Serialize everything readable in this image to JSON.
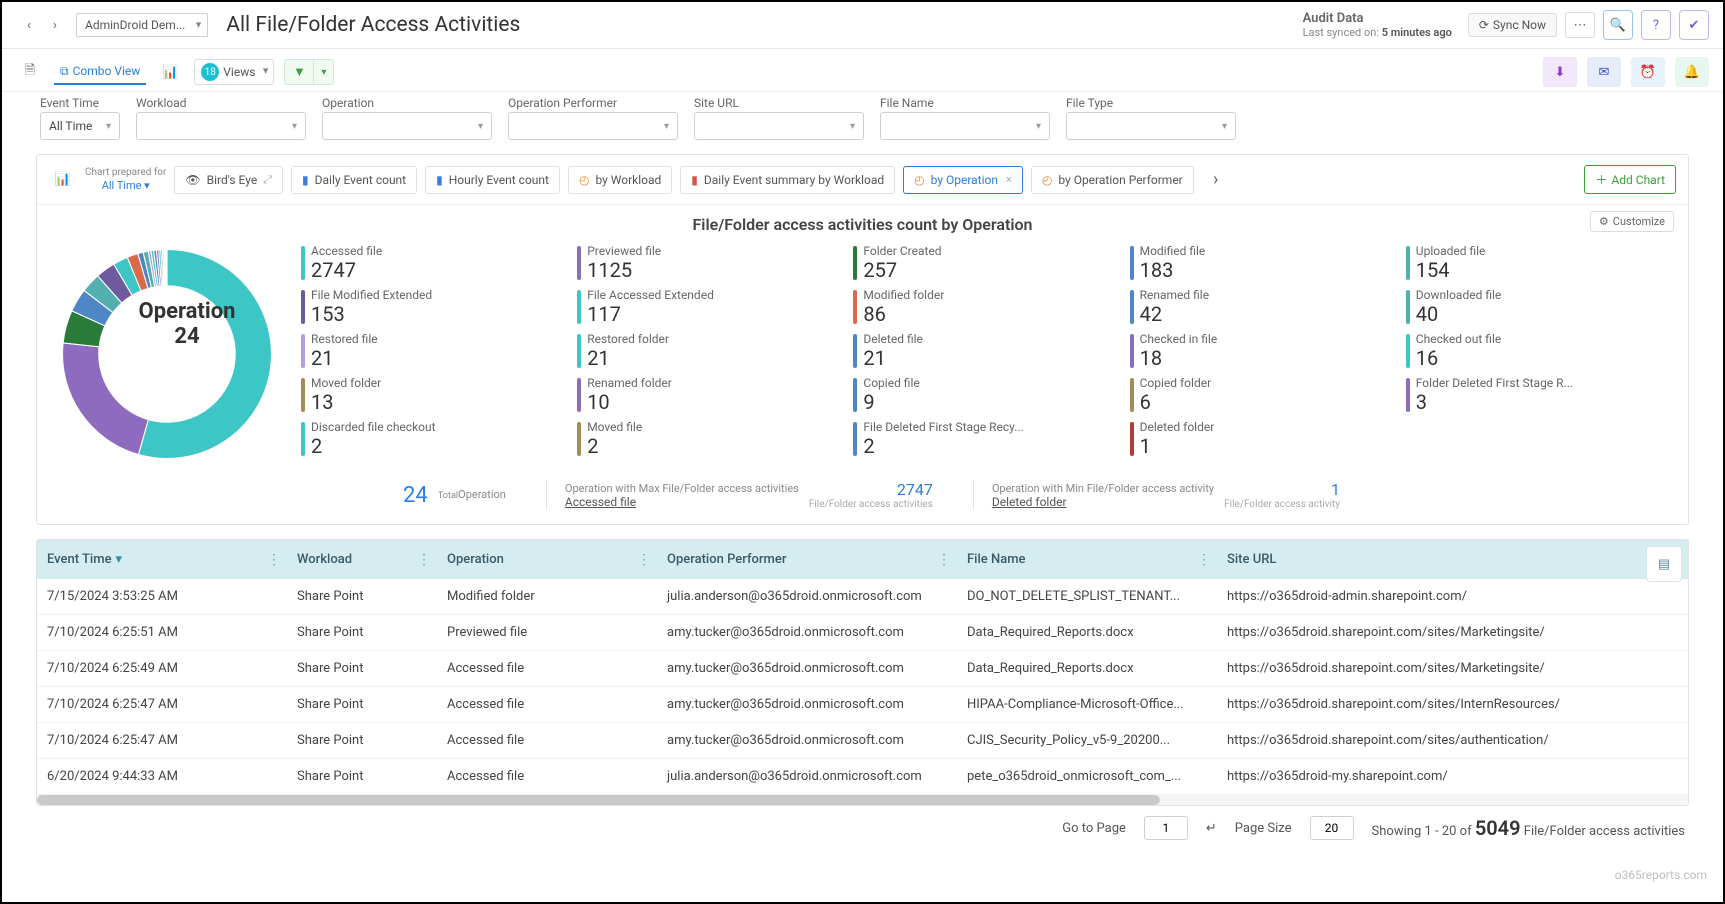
{
  "header": {
    "tenant": "AdminDroid Dem...",
    "page_title": "All File/Folder Access Activities",
    "audit_label": "Audit Data",
    "synced_label": "Last synced on:",
    "synced_value": "5 minutes ago",
    "sync_btn": "Sync Now"
  },
  "toolbar": {
    "combo_label": "Combo View",
    "views_label": "Views",
    "views_count": "18"
  },
  "filters": {
    "event_time": {
      "label": "Event Time",
      "value": "All Time"
    },
    "workload": {
      "label": "Workload",
      "value": ""
    },
    "operation": {
      "label": "Operation",
      "value": ""
    },
    "performer": {
      "label": "Operation Performer",
      "value": ""
    },
    "site_url": {
      "label": "Site URL",
      "value": ""
    },
    "file_name": {
      "label": "File Name",
      "value": ""
    },
    "file_type": {
      "label": "File Type",
      "value": ""
    }
  },
  "chart": {
    "prepared_label": "Chart prepared for",
    "prepared_value": "All Time",
    "tabs": {
      "birds_eye": "Bird's Eye",
      "daily": "Daily Event count",
      "hourly": "Hourly Event count",
      "by_workload": "by Workload",
      "daily_workload": "Daily Event summary by Workload",
      "by_operation": "by Operation",
      "by_performer": "by Operation Performer"
    },
    "add_chart": "Add Chart",
    "title": "File/Folder access activities count by Operation",
    "customize": "Customize",
    "donut_label": "Operation",
    "donut_value": "24",
    "footer": {
      "total_num": "24",
      "total_label_small": "Total",
      "total_label": "Operation",
      "max_label": "Operation with Max File/Folder access activities",
      "max_link": "Accessed file",
      "max_num": "2747",
      "max_sub": "File/Folder access activities",
      "min_label": "Operation with Min File/Folder access activity",
      "min_link": "Deleted folder",
      "min_num": "1",
      "min_sub": "File/Folder access activity"
    }
  },
  "chart_data": {
    "type": "pie",
    "title": "File/Folder access activities count by Operation",
    "series": [
      {
        "name": "Accessed file",
        "value": 2747,
        "color": "#3cc6c6"
      },
      {
        "name": "Previewed file",
        "value": 1125,
        "color": "#8e6bbf"
      },
      {
        "name": "Folder Created",
        "value": 257,
        "color": "#2a7a3a"
      },
      {
        "name": "Modified file",
        "value": 183,
        "color": "#4f86c6"
      },
      {
        "name": "Uploaded file",
        "value": 154,
        "color": "#54b0b0"
      },
      {
        "name": "File Modified Extended",
        "value": 153,
        "color": "#6f5a9e"
      },
      {
        "name": "File Accessed Extended",
        "value": 117,
        "color": "#3cc6c6"
      },
      {
        "name": "Modified folder",
        "value": 86,
        "color": "#d96a4a"
      },
      {
        "name": "Renamed file",
        "value": 42,
        "color": "#4f86c6"
      },
      {
        "name": "Downloaded file",
        "value": 40,
        "color": "#54b0b0"
      },
      {
        "name": "Restored file",
        "value": 21,
        "color": "#b59bdf"
      },
      {
        "name": "Restored folder",
        "value": 21,
        "color": "#3cc6c6"
      },
      {
        "name": "Deleted file",
        "value": 21,
        "color": "#4f86c6"
      },
      {
        "name": "Checked in file",
        "value": 18,
        "color": "#8e6bbf"
      },
      {
        "name": "Checked out file",
        "value": 16,
        "color": "#3cc6c6"
      },
      {
        "name": "Moved folder",
        "value": 13,
        "color": "#a58a5a"
      },
      {
        "name": "Renamed folder",
        "value": 10,
        "color": "#8e6bbf"
      },
      {
        "name": "Copied file",
        "value": 9,
        "color": "#4f86c6"
      },
      {
        "name": "Copied folder",
        "value": 6,
        "color": "#a58a5a"
      },
      {
        "name": "Folder Deleted First Stage R...",
        "value": 3,
        "color": "#8e6bbf"
      },
      {
        "name": "Discarded file checkout",
        "value": 2,
        "color": "#3cc6c6"
      },
      {
        "name": "Moved file",
        "value": 2,
        "color": "#a58a5a"
      },
      {
        "name": "File Deleted First Stage Recy...",
        "value": 2,
        "color": "#4f86c6"
      },
      {
        "name": "Deleted folder",
        "value": 1,
        "color": "#b23a3a"
      }
    ]
  },
  "table": {
    "columns": {
      "time": "Event Time",
      "workload": "Workload",
      "operation": "Operation",
      "performer": "Operation Performer",
      "file": "File Name",
      "url": "Site URL"
    },
    "rows": [
      {
        "time": "7/15/2024 3:53:25 AM",
        "workload": "Share Point",
        "operation": "Modified folder",
        "performer": "julia.anderson@o365droid.onmicrosoft.com",
        "file": "DO_NOT_DELETE_SPLIST_TENANT...",
        "url": "https://o365droid-admin.sharepoint.com/"
      },
      {
        "time": "7/10/2024 6:25:51 AM",
        "workload": "Share Point",
        "operation": "Previewed file",
        "performer": "amy.tucker@o365droid.onmicrosoft.com",
        "file": "Data_Required_Reports.docx",
        "url": "https://o365droid.sharepoint.com/sites/Marketingsite/"
      },
      {
        "time": "7/10/2024 6:25:49 AM",
        "workload": "Share Point",
        "operation": "Accessed file",
        "performer": "amy.tucker@o365droid.onmicrosoft.com",
        "file": "Data_Required_Reports.docx",
        "url": "https://o365droid.sharepoint.com/sites/Marketingsite/"
      },
      {
        "time": "7/10/2024 6:25:47 AM",
        "workload": "Share Point",
        "operation": "Accessed file",
        "performer": "amy.tucker@o365droid.onmicrosoft.com",
        "file": "HIPAA-Compliance-Microsoft-Office...",
        "url": "https://o365droid.sharepoint.com/sites/InternResources/"
      },
      {
        "time": "7/10/2024 6:25:47 AM",
        "workload": "Share Point",
        "operation": "Accessed file",
        "performer": "amy.tucker@o365droid.onmicrosoft.com",
        "file": "CJIS_Security_Policy_v5-9_20200...",
        "url": "https://o365droid.sharepoint.com/sites/authentication/"
      },
      {
        "time": "6/20/2024 9:44:33 AM",
        "workload": "Share Point",
        "operation": "Accessed file",
        "performer": "julia.anderson@o365droid.onmicrosoft.com",
        "file": "pete_o365droid_onmicrosoft_com_...",
        "url": "https://o365droid-my.sharepoint.com/"
      }
    ]
  },
  "pager": {
    "goto_label": "Go to Page",
    "goto_value": "1",
    "size_label": "Page Size",
    "size_value": "20",
    "showing_prefix": "Showing 1 - 20 of",
    "total": "5049",
    "showing_suffix": "File/Folder access activities"
  },
  "watermark": "o365reports.com"
}
